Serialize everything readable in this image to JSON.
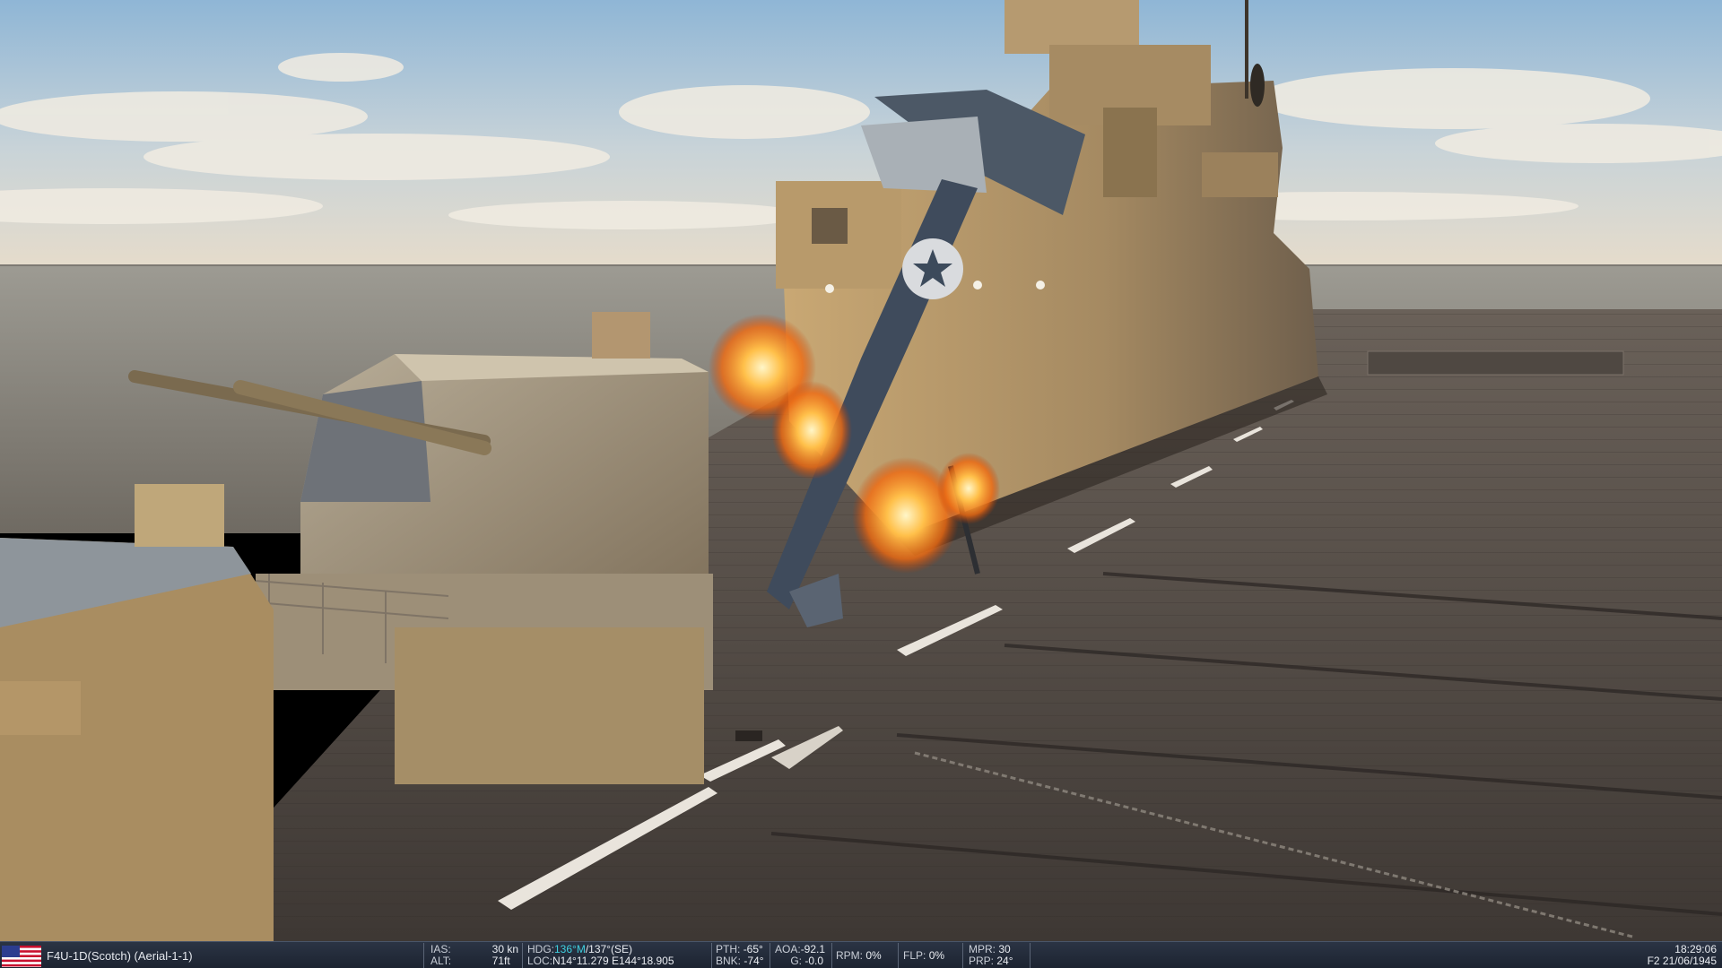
{
  "status_bar": {
    "unit": "F4U-1D(Scotch) (Aerial-1-1)",
    "flag_icon": "us-flag-icon",
    "ias_label": "IAS:",
    "ias_value": "30",
    "ias_unit": "kn",
    "alt_label": "ALT:",
    "alt_value": "71",
    "alt_unit": "ft",
    "hdg_label": "HDG:",
    "hdg_value": "136°M",
    "hdg_true": "/137°(SE)",
    "loc_label": "LOC:",
    "loc_value": "N14°11.279 E144°18.905",
    "pth_label": "PTH:",
    "pth_value": "-65°",
    "bnk_label": "BNK:",
    "bnk_value": "-74°",
    "aoa_label": "AOA:",
    "aoa_value": "-92.1",
    "g_label": "G:",
    "g_value": "-0.0",
    "rpm_label": "RPM:",
    "rpm_value": "0%",
    "flp_label": "FLP:",
    "flp_value": "0%",
    "mpr_label": "MPR:",
    "mpr_value": "30",
    "prp_label": "PRP:",
    "prp_value": "24°",
    "time": "18:29:06",
    "date": "F2 21/06/1945",
    "highlight_color": "#3fd0e0",
    "bar_color": "#1f2733"
  }
}
